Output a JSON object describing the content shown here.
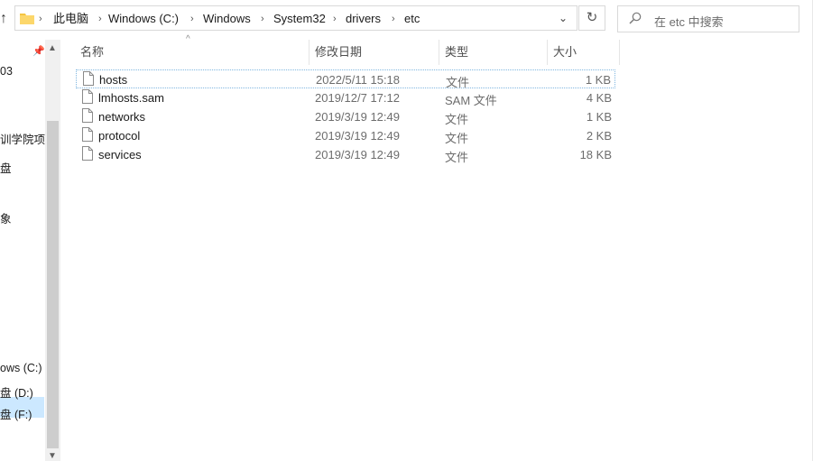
{
  "address_bar": {
    "breadcrumbs": [
      "此电脑",
      "Windows (C:)",
      "Windows",
      "System32",
      "drivers",
      "etc"
    ]
  },
  "search": {
    "placeholder": "在 etc 中搜索"
  },
  "nav_pane": {
    "items": [
      {
        "label": "03"
      },
      {
        "label": "训学院项"
      },
      {
        "label": "盘"
      },
      {
        "label": "象"
      },
      {
        "label": "ows  (C:)",
        "selected": true
      },
      {
        "label": "盘 (D:)"
      },
      {
        "label": "盘 (F:)"
      }
    ]
  },
  "columns": {
    "name": "名称",
    "date": "修改日期",
    "type": "类型",
    "size": "大小"
  },
  "files": [
    {
      "name": "hosts",
      "date": "2022/5/11 15:18",
      "type": "文件",
      "size": "1 KB",
      "selected": true
    },
    {
      "name": "lmhosts.sam",
      "date": "2019/12/7 17:12",
      "type": "SAM 文件",
      "size": "4 KB"
    },
    {
      "name": "networks",
      "date": "2019/3/19 12:49",
      "type": "文件",
      "size": "1 KB"
    },
    {
      "name": "protocol",
      "date": "2019/3/19 12:49",
      "type": "文件",
      "size": "2 KB"
    },
    {
      "name": "services",
      "date": "2019/3/19 12:49",
      "type": "文件",
      "size": "18 KB"
    }
  ],
  "colors": {
    "selection": "#cce8ff",
    "folder_yellow": "#f5c542",
    "border": "#d9d9d9"
  }
}
